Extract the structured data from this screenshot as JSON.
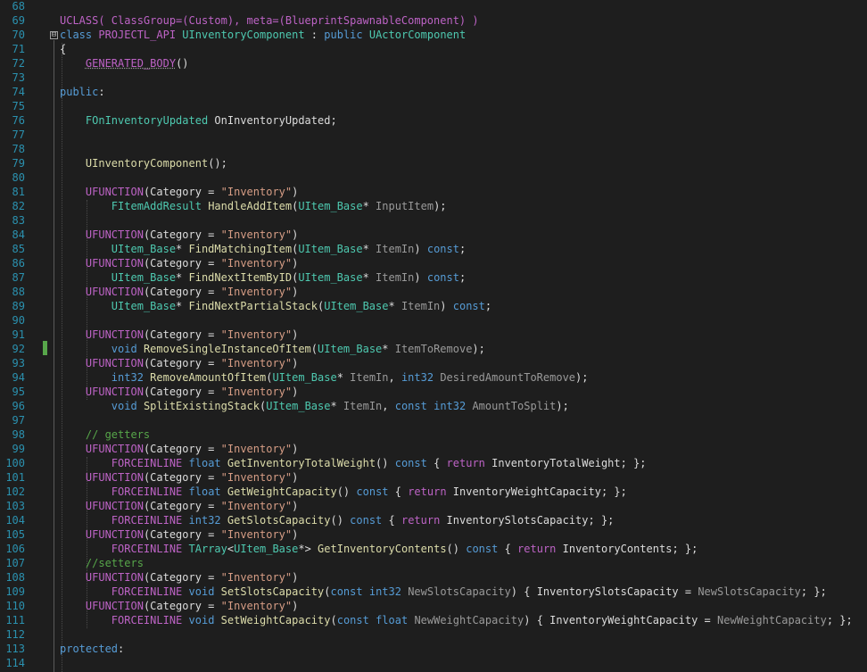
{
  "editor": {
    "fold_toggle": "⊟",
    "lines": [
      {
        "n": "68",
        "t": []
      },
      {
        "n": "69",
        "t": [
          [
            "UCLASS( ClassGroup=(Custom), meta=(BlueprintSpawnableComponent) )",
            "mac"
          ]
        ]
      },
      {
        "n": "70",
        "t": [
          [
            "class",
            "kw"
          ],
          [
            " ",
            "pl"
          ],
          [
            "PROJECTL_API",
            "mac"
          ],
          [
            " ",
            "pl"
          ],
          [
            "UInventoryComponent",
            "ty"
          ],
          [
            " : ",
            "pl"
          ],
          [
            "public",
            "kw"
          ],
          [
            " ",
            "pl"
          ],
          [
            "UActorComponent",
            "ty"
          ]
        ]
      },
      {
        "n": "71",
        "t": [
          [
            "{",
            "pl"
          ]
        ]
      },
      {
        "n": "72",
        "t": [
          [
            "    ",
            "pl"
          ],
          [
            "GENERATED_BODY",
            "mac ud"
          ],
          [
            "()",
            "pl"
          ]
        ]
      },
      {
        "n": "73",
        "t": []
      },
      {
        "n": "74",
        "t": [
          [
            "public",
            "kw"
          ],
          [
            ":",
            "pl"
          ]
        ]
      },
      {
        "n": "75",
        "t": []
      },
      {
        "n": "76",
        "t": [
          [
            "    ",
            "pl"
          ],
          [
            "FOnInventoryUpdated",
            "ty"
          ],
          [
            " OnInventoryUpdated;",
            "pl"
          ]
        ]
      },
      {
        "n": "77",
        "t": []
      },
      {
        "n": "78",
        "t": []
      },
      {
        "n": "79",
        "t": [
          [
            "    ",
            "pl"
          ],
          [
            "UInventoryComponent",
            "fn"
          ],
          [
            "();",
            "pl"
          ]
        ]
      },
      {
        "n": "80",
        "t": []
      },
      {
        "n": "81",
        "t": [
          [
            "    ",
            "pl"
          ],
          [
            "UFUNCTION",
            "mac"
          ],
          [
            "(Category = ",
            "pl"
          ],
          [
            "\"Inventory\"",
            "str"
          ],
          [
            ")",
            "pl"
          ]
        ]
      },
      {
        "n": "82",
        "t": [
          [
            "        ",
            "pl"
          ],
          [
            "FItemAddResult",
            "ty"
          ],
          [
            " ",
            "pl"
          ],
          [
            "HandleAddItem",
            "fn"
          ],
          [
            "(",
            "pl"
          ],
          [
            "UItem_Base",
            "ty"
          ],
          [
            "* ",
            "pl"
          ],
          [
            "InputItem",
            "pa"
          ],
          [
            ");",
            "pl"
          ]
        ]
      },
      {
        "n": "83",
        "t": []
      },
      {
        "n": "84",
        "t": [
          [
            "    ",
            "pl"
          ],
          [
            "UFUNCTION",
            "mac"
          ],
          [
            "(Category = ",
            "pl"
          ],
          [
            "\"Inventory\"",
            "str"
          ],
          [
            ")",
            "pl"
          ]
        ]
      },
      {
        "n": "85",
        "t": [
          [
            "        ",
            "pl"
          ],
          [
            "UItem_Base",
            "ty"
          ],
          [
            "* ",
            "pl"
          ],
          [
            "FindMatchingItem",
            "fn"
          ],
          [
            "(",
            "pl"
          ],
          [
            "UItem_Base",
            "ty"
          ],
          [
            "* ",
            "pl"
          ],
          [
            "ItemIn",
            "pa"
          ],
          [
            ") ",
            "pl"
          ],
          [
            "const",
            "kw"
          ],
          [
            ";",
            "pl"
          ]
        ]
      },
      {
        "n": "86",
        "t": [
          [
            "    ",
            "pl"
          ],
          [
            "UFUNCTION",
            "mac"
          ],
          [
            "(Category = ",
            "pl"
          ],
          [
            "\"Inventory\"",
            "str"
          ],
          [
            ")",
            "pl"
          ]
        ]
      },
      {
        "n": "87",
        "t": [
          [
            "        ",
            "pl"
          ],
          [
            "UItem_Base",
            "ty"
          ],
          [
            "* ",
            "pl"
          ],
          [
            "FindNextItemByID",
            "fn"
          ],
          [
            "(",
            "pl"
          ],
          [
            "UItem_Base",
            "ty"
          ],
          [
            "* ",
            "pl"
          ],
          [
            "ItemIn",
            "pa"
          ],
          [
            ") ",
            "pl"
          ],
          [
            "const",
            "kw"
          ],
          [
            ";",
            "pl"
          ]
        ]
      },
      {
        "n": "88",
        "t": [
          [
            "    ",
            "pl"
          ],
          [
            "UFUNCTION",
            "mac"
          ],
          [
            "(Category = ",
            "pl"
          ],
          [
            "\"Inventory\"",
            "str"
          ],
          [
            ")",
            "pl"
          ]
        ]
      },
      {
        "n": "89",
        "t": [
          [
            "        ",
            "pl"
          ],
          [
            "UItem_Base",
            "ty"
          ],
          [
            "* ",
            "pl"
          ],
          [
            "FindNextPartialStack",
            "fn"
          ],
          [
            "(",
            "pl"
          ],
          [
            "UItem_Base",
            "ty"
          ],
          [
            "* ",
            "pl"
          ],
          [
            "ItemIn",
            "pa"
          ],
          [
            ") ",
            "pl"
          ],
          [
            "const",
            "kw"
          ],
          [
            ";",
            "pl"
          ]
        ]
      },
      {
        "n": "90",
        "t": []
      },
      {
        "n": "91",
        "t": [
          [
            "    ",
            "pl"
          ],
          [
            "UFUNCTION",
            "mac"
          ],
          [
            "(Category = ",
            "pl"
          ],
          [
            "\"Inventory\"",
            "str"
          ],
          [
            ")",
            "pl"
          ]
        ]
      },
      {
        "n": "92",
        "t": [
          [
            "        ",
            "pl"
          ],
          [
            "void",
            "kw"
          ],
          [
            " ",
            "pl"
          ],
          [
            "RemoveSingleInstanceOfItem",
            "fn"
          ],
          [
            "(",
            "pl"
          ],
          [
            "UItem_Base",
            "ty"
          ],
          [
            "* ",
            "pl"
          ],
          [
            "ItemToRemove",
            "pa"
          ],
          [
            ");",
            "pl"
          ]
        ]
      },
      {
        "n": "93",
        "t": [
          [
            "    ",
            "pl"
          ],
          [
            "UFUNCTION",
            "mac"
          ],
          [
            "(Category = ",
            "pl"
          ],
          [
            "\"Inventory\"",
            "str"
          ],
          [
            ")",
            "pl"
          ]
        ]
      },
      {
        "n": "94",
        "t": [
          [
            "        ",
            "pl"
          ],
          [
            "int32",
            "kw"
          ],
          [
            " ",
            "pl"
          ],
          [
            "RemoveAmountOfItem",
            "fn"
          ],
          [
            "(",
            "pl"
          ],
          [
            "UItem_Base",
            "ty"
          ],
          [
            "* ",
            "pl"
          ],
          [
            "ItemIn",
            "pa"
          ],
          [
            ", ",
            "pl"
          ],
          [
            "int32",
            "kw"
          ],
          [
            " ",
            "pl"
          ],
          [
            "DesiredAmountToRemove",
            "pa"
          ],
          [
            ");",
            "pl"
          ]
        ]
      },
      {
        "n": "95",
        "t": [
          [
            "    ",
            "pl"
          ],
          [
            "UFUNCTION",
            "mac"
          ],
          [
            "(Category = ",
            "pl"
          ],
          [
            "\"Inventory\"",
            "str"
          ],
          [
            ")",
            "pl"
          ]
        ]
      },
      {
        "n": "96",
        "t": [
          [
            "        ",
            "pl"
          ],
          [
            "void",
            "kw"
          ],
          [
            " ",
            "pl"
          ],
          [
            "SplitExistingStack",
            "fn"
          ],
          [
            "(",
            "pl"
          ],
          [
            "UItem_Base",
            "ty"
          ],
          [
            "* ",
            "pl"
          ],
          [
            "ItemIn",
            "pa"
          ],
          [
            ", ",
            "pl"
          ],
          [
            "const",
            "kw"
          ],
          [
            " ",
            "pl"
          ],
          [
            "int32",
            "kw"
          ],
          [
            " ",
            "pl"
          ],
          [
            "AmountToSplit",
            "pa"
          ],
          [
            ");",
            "pl"
          ]
        ]
      },
      {
        "n": "97",
        "t": []
      },
      {
        "n": "98",
        "t": [
          [
            "    ",
            "pl"
          ],
          [
            "// getters",
            "cm"
          ]
        ]
      },
      {
        "n": "99",
        "t": [
          [
            "    ",
            "pl"
          ],
          [
            "UFUNCTION",
            "mac"
          ],
          [
            "(Category = ",
            "pl"
          ],
          [
            "\"Inventory\"",
            "str"
          ],
          [
            ")",
            "pl"
          ]
        ]
      },
      {
        "n": "100",
        "t": [
          [
            "        ",
            "pl"
          ],
          [
            "FORCEINLINE",
            "mac"
          ],
          [
            " ",
            "pl"
          ],
          [
            "float",
            "kw"
          ],
          [
            " ",
            "pl"
          ],
          [
            "GetInventoryTotalWeight",
            "fn"
          ],
          [
            "() ",
            "pl"
          ],
          [
            "const",
            "kw"
          ],
          [
            " { ",
            "pl"
          ],
          [
            "return",
            "mac"
          ],
          [
            " InventoryTotalWeight; };",
            "pl"
          ]
        ]
      },
      {
        "n": "101",
        "t": [
          [
            "    ",
            "pl"
          ],
          [
            "UFUNCTION",
            "mac"
          ],
          [
            "(Category = ",
            "pl"
          ],
          [
            "\"Inventory\"",
            "str"
          ],
          [
            ")",
            "pl"
          ]
        ]
      },
      {
        "n": "102",
        "t": [
          [
            "        ",
            "pl"
          ],
          [
            "FORCEINLINE",
            "mac"
          ],
          [
            " ",
            "pl"
          ],
          [
            "float",
            "kw"
          ],
          [
            " ",
            "pl"
          ],
          [
            "GetWeightCapacity",
            "fn"
          ],
          [
            "() ",
            "pl"
          ],
          [
            "const",
            "kw"
          ],
          [
            " { ",
            "pl"
          ],
          [
            "return",
            "mac"
          ],
          [
            " InventoryWeightCapacity; };",
            "pl"
          ]
        ]
      },
      {
        "n": "103",
        "t": [
          [
            "    ",
            "pl"
          ],
          [
            "UFUNCTION",
            "mac"
          ],
          [
            "(Category = ",
            "pl"
          ],
          [
            "\"Inventory\"",
            "str"
          ],
          [
            ")",
            "pl"
          ]
        ]
      },
      {
        "n": "104",
        "t": [
          [
            "        ",
            "pl"
          ],
          [
            "FORCEINLINE",
            "mac"
          ],
          [
            " ",
            "pl"
          ],
          [
            "int32",
            "kw"
          ],
          [
            " ",
            "pl"
          ],
          [
            "GetSlotsCapacity",
            "fn"
          ],
          [
            "() ",
            "pl"
          ],
          [
            "const",
            "kw"
          ],
          [
            " { ",
            "pl"
          ],
          [
            "return",
            "mac"
          ],
          [
            " InventorySlotsCapacity; };",
            "pl"
          ]
        ]
      },
      {
        "n": "105",
        "t": [
          [
            "    ",
            "pl"
          ],
          [
            "UFUNCTION",
            "mac"
          ],
          [
            "(Category = ",
            "pl"
          ],
          [
            "\"Inventory\"",
            "str"
          ],
          [
            ")",
            "pl"
          ]
        ]
      },
      {
        "n": "106",
        "t": [
          [
            "        ",
            "pl"
          ],
          [
            "FORCEINLINE",
            "mac"
          ],
          [
            " ",
            "pl"
          ],
          [
            "TArray",
            "ty"
          ],
          [
            "<",
            "pl"
          ],
          [
            "UItem_Base",
            "ty"
          ],
          [
            "*> ",
            "pl"
          ],
          [
            "GetInventoryContents",
            "fn"
          ],
          [
            "() ",
            "pl"
          ],
          [
            "const",
            "kw"
          ],
          [
            " { ",
            "pl"
          ],
          [
            "return",
            "mac"
          ],
          [
            " InventoryContents; };",
            "pl"
          ]
        ]
      },
      {
        "n": "107",
        "t": [
          [
            "    ",
            "pl"
          ],
          [
            "//setters",
            "cm"
          ]
        ]
      },
      {
        "n": "108",
        "t": [
          [
            "    ",
            "pl"
          ],
          [
            "UFUNCTION",
            "mac"
          ],
          [
            "(Category = ",
            "pl"
          ],
          [
            "\"Inventory\"",
            "str"
          ],
          [
            ")",
            "pl"
          ]
        ]
      },
      {
        "n": "109",
        "t": [
          [
            "        ",
            "pl"
          ],
          [
            "FORCEINLINE",
            "mac"
          ],
          [
            " ",
            "pl"
          ],
          [
            "void",
            "kw"
          ],
          [
            " ",
            "pl"
          ],
          [
            "SetSlotsCapacity",
            "fn"
          ],
          [
            "(",
            "pl"
          ],
          [
            "const",
            "kw"
          ],
          [
            " ",
            "pl"
          ],
          [
            "int32",
            "kw"
          ],
          [
            " ",
            "pl"
          ],
          [
            "NewSlotsCapacity",
            "pa"
          ],
          [
            ") { InventorySlotsCapacity = ",
            "pl"
          ],
          [
            "NewSlotsCapacity",
            "pa"
          ],
          [
            "; };",
            "pl"
          ]
        ]
      },
      {
        "n": "110",
        "t": [
          [
            "    ",
            "pl"
          ],
          [
            "UFUNCTION",
            "mac"
          ],
          [
            "(Category = ",
            "pl"
          ],
          [
            "\"Inventory\"",
            "str"
          ],
          [
            ")",
            "pl"
          ]
        ]
      },
      {
        "n": "111",
        "t": [
          [
            "        ",
            "pl"
          ],
          [
            "FORCEINLINE",
            "mac"
          ],
          [
            " ",
            "pl"
          ],
          [
            "void",
            "kw"
          ],
          [
            " ",
            "pl"
          ],
          [
            "SetWeightCapacity",
            "fn"
          ],
          [
            "(",
            "pl"
          ],
          [
            "const",
            "kw"
          ],
          [
            " ",
            "pl"
          ],
          [
            "float",
            "kw"
          ],
          [
            " ",
            "pl"
          ],
          [
            "NewWeightCapacity",
            "pa"
          ],
          [
            ") { InventoryWeightCapacity = ",
            "pl"
          ],
          [
            "NewWeightCapacity",
            "pa"
          ],
          [
            "; };",
            "pl"
          ]
        ]
      },
      {
        "n": "112",
        "t": []
      },
      {
        "n": "113",
        "t": [
          [
            "protected",
            "kw"
          ],
          [
            ":",
            "pl"
          ]
        ]
      },
      {
        "n": "114",
        "t": []
      }
    ],
    "colors": {
      "background": "#1e1e1e",
      "line_number": "#2b91af",
      "keyword": "#569cd6",
      "type": "#4ec9b0",
      "function": "#dcdcaa",
      "string": "#d69d85",
      "comment": "#57a64a",
      "macro": "#bd63c5",
      "parameter": "#9a9a9a",
      "change_marker": "#57a64a"
    }
  }
}
